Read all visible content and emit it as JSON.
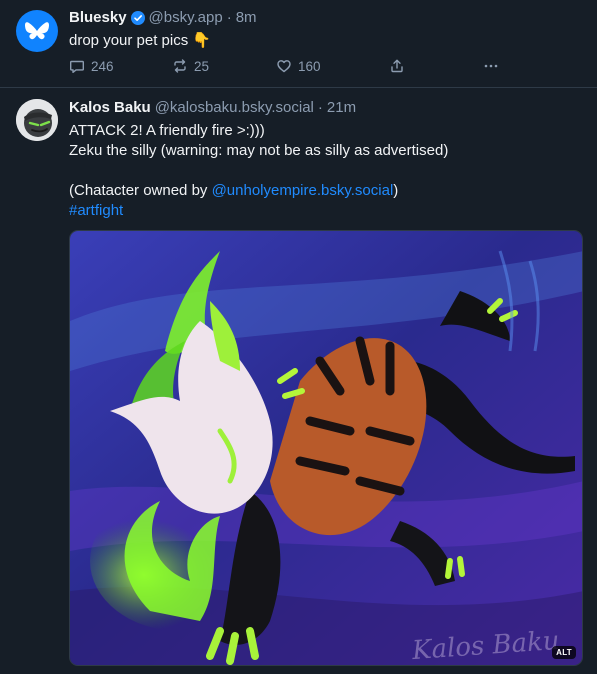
{
  "posts": [
    {
      "display_name": "Bluesky",
      "verified": true,
      "handle": "@bsky.app",
      "time": "8m",
      "text_lines": [
        "drop your pet pics 👇"
      ],
      "reply_count": "246",
      "repost_count": "25",
      "like_count": "160",
      "avatar_icon": "butterfly-icon",
      "accent_color": "#1083fe"
    },
    {
      "display_name": "Kalos Baku",
      "handle": "@kalosbaku.bsky.social",
      "time": "21m",
      "text_lines": [
        "ATTACK 2! A friendly fire >:)))",
        "Zeku the silly (warning: may not be as silly as advertised)"
      ],
      "credit_prefix": "(Chatacter owned by ",
      "credit_link": "@unholyempire.bsky.social",
      "credit_suffix": ")",
      "hashtag": "#artfight",
      "image_alt_badge": "ALT",
      "image_signature": "Kalos Baku"
    }
  ],
  "colors": {
    "background": "#161e27",
    "text": "#f1f3f5",
    "muted": "#8c9cb0",
    "link": "#208bfe",
    "divider": "#2e3a47"
  },
  "separator": "·"
}
